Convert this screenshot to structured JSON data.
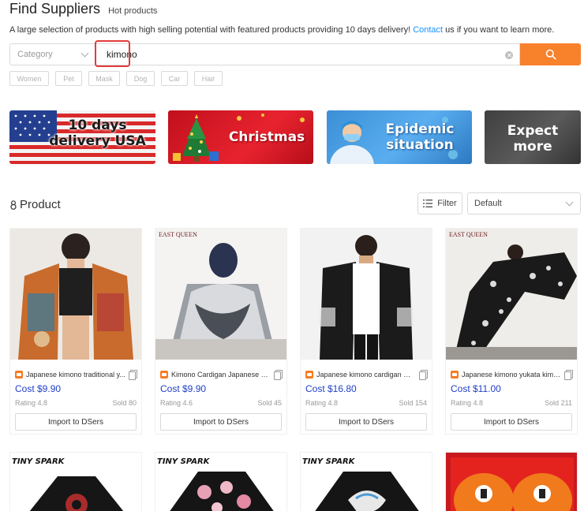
{
  "header": {
    "title": "Find Suppliers",
    "subtitle": "Hot products",
    "description_pre": "A large selection of products with high selling potential with featured products providing 10 days delivery! ",
    "description_link": "Contact",
    "description_post": " us if you want to learn more."
  },
  "search": {
    "category_placeholder": "Category",
    "query": "kimono"
  },
  "tags": [
    "Women",
    "Pet",
    "Mask",
    "Dog",
    "Car",
    "Hair"
  ],
  "banners": [
    {
      "line1": "10 days",
      "line2": "delivery USA"
    },
    {
      "line1": "Christmas"
    },
    {
      "line1": "Epidemic",
      "line2": "situation"
    },
    {
      "line1": "Expect",
      "line2": "more"
    }
  ],
  "product_section": {
    "title": "Product",
    "filter_label": "Filter",
    "sort_value": "Default"
  },
  "products": [
    {
      "title": "Japanese kimono traditional y...",
      "cost": "Cost $9.90",
      "rating": "Rating 4.8",
      "sold": "Sold 80",
      "button": "Import to DSers"
    },
    {
      "title": "Kimono Cardigan Japanese Ja...",
      "cost": "Cost $9.90",
      "rating": "Rating 4.6",
      "sold": "Sold 45",
      "button": "Import to DSers",
      "brand": "EAST QUEEN"
    },
    {
      "title": "Japanese kimono cardigan me...",
      "cost": "Cost $16.80",
      "rating": "Rating 4.8",
      "sold": "Sold 154",
      "button": "Import to DSers"
    },
    {
      "title": "Japanese kimono yukata kimo...",
      "cost": "Cost $11.00",
      "rating": "Rating 4.8",
      "sold": "Sold 211",
      "button": "Import to DSers",
      "brand": "EAST QUEEN"
    }
  ],
  "bottom_brands": [
    "TINY SPARK",
    "TINY SPARK",
    "TINY SPARK"
  ],
  "colors": {
    "accent_orange": "#f8812c",
    "cost_blue": "#1f3ec7",
    "link_blue": "#1890ff",
    "highlight_red": "#e23b3b"
  }
}
